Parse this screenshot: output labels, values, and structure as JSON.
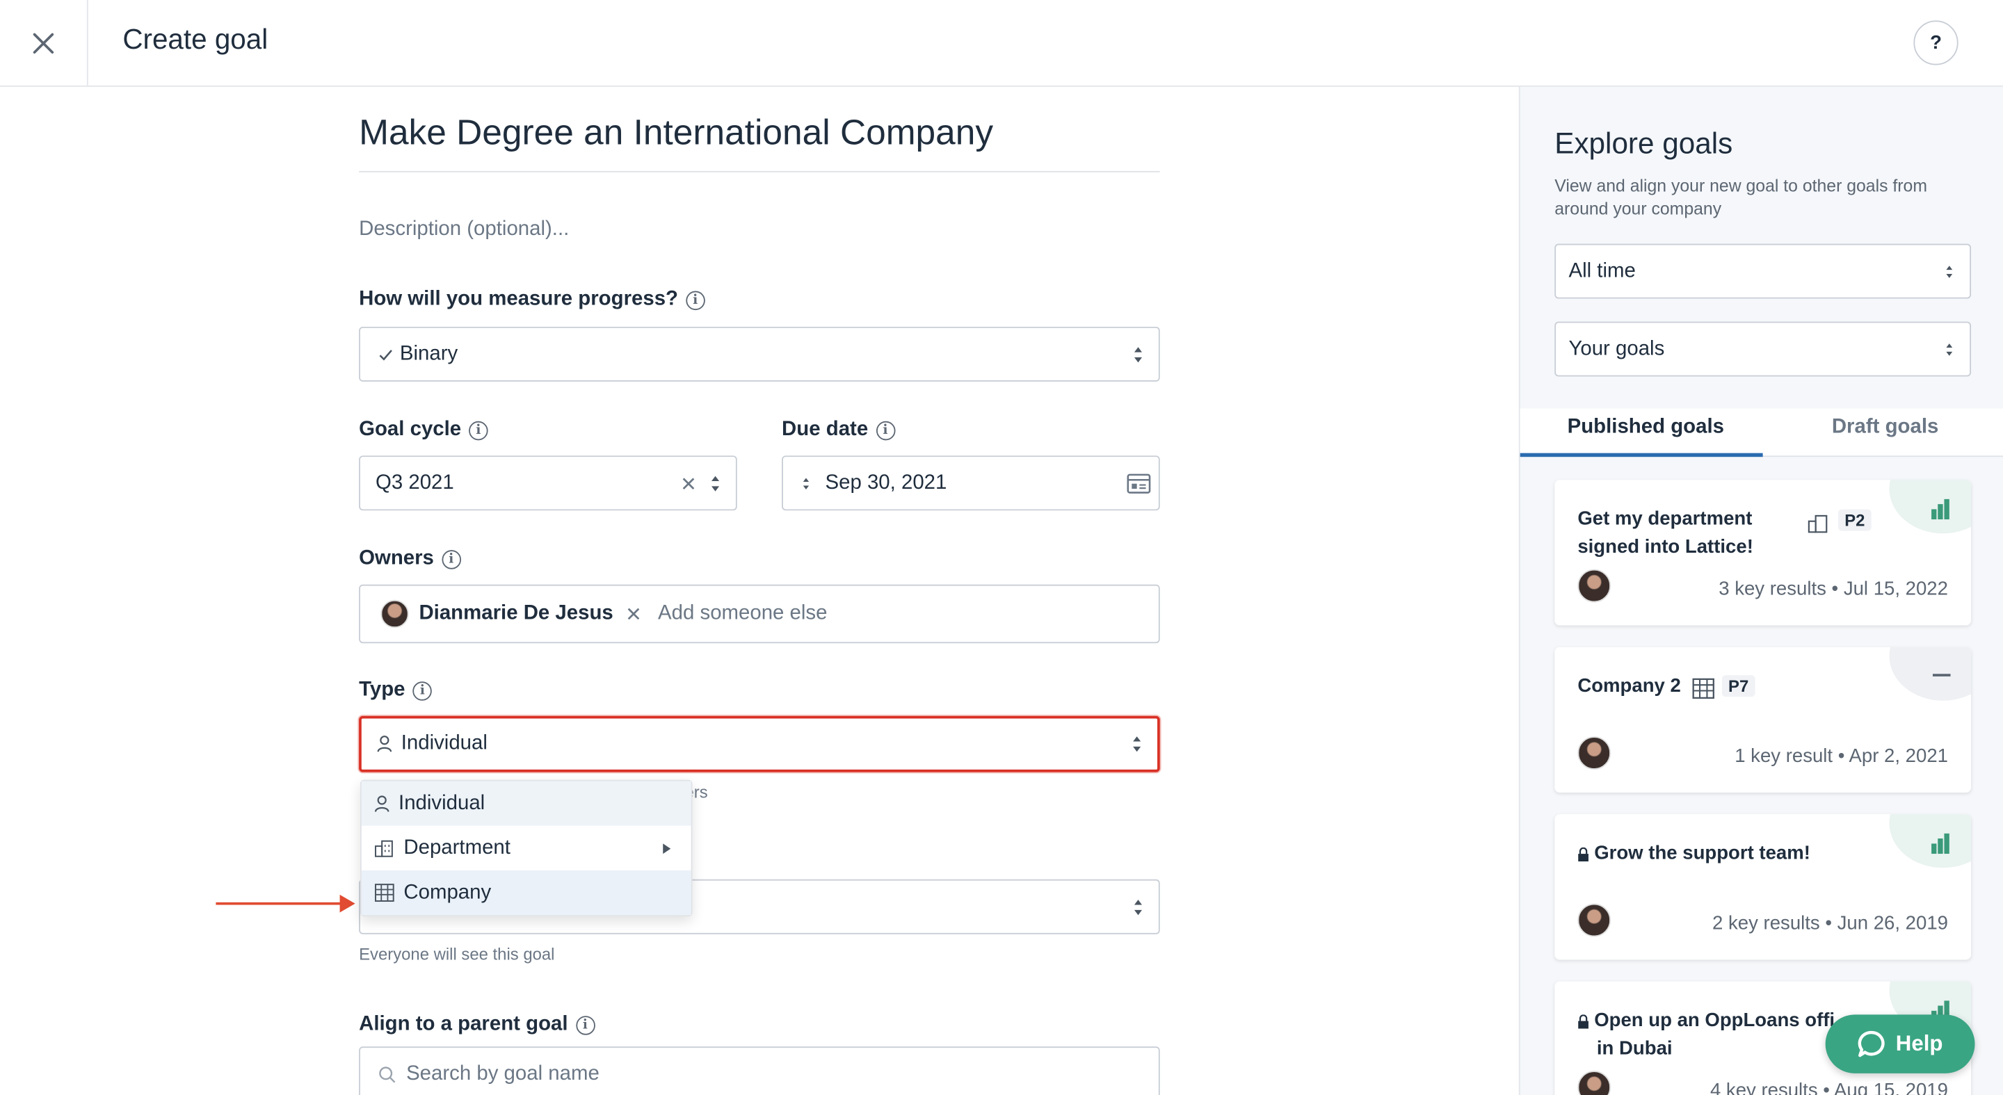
{
  "header": {
    "title": "Create goal",
    "help_label": "?"
  },
  "form": {
    "goal_title": "Make Degree an International Company",
    "description_placeholder": "Description (optional)...",
    "measure": {
      "label": "How will you measure progress?",
      "value": "Binary"
    },
    "goal_cycle": {
      "label": "Goal cycle",
      "value": "Q3 2021"
    },
    "due_date": {
      "label": "Due date",
      "value": "Sep 30, 2021"
    },
    "owners": {
      "label": "Owners",
      "owner_name": "Dianmarie De Jesus",
      "add_placeholder": "Add someone else"
    },
    "type": {
      "label": "Type",
      "value": "Individual",
      "hint_partial": "ers",
      "options": [
        {
          "label": "Individual",
          "icon": "person-icon"
        },
        {
          "label": "Department",
          "icon": "department-icon"
        },
        {
          "label": "Company",
          "icon": "company-icon"
        }
      ]
    },
    "visibility": {
      "hint": "Everyone will see this goal"
    },
    "parent_goal": {
      "label": "Align to a parent goal",
      "search_placeholder": "Search by goal name"
    }
  },
  "explore": {
    "title": "Explore goals",
    "description": "View and align your new goal to other goals from around your company",
    "time_filter": "All time",
    "scope_filter": "Your goals",
    "tabs": [
      "Published goals",
      "Draft goals"
    ],
    "cards": [
      {
        "title_line1": "Get my department",
        "title_line2": "signed into Lattice!",
        "badge": "P2",
        "meta": "3 key results • Jul 15, 2022",
        "status_icon": "bar-chart-icon"
      },
      {
        "title_line1": "Company 2",
        "badge": "P7",
        "meta": "1 key result • Apr 2, 2021",
        "status_icon": "minus-icon"
      },
      {
        "title_line1": "Grow the support team!",
        "meta": "2 key results • Jun 26, 2019",
        "status_icon": "bar-chart-icon"
      },
      {
        "title_line1": "Open up an OppLoans offi",
        "title_line2": "in Dubai",
        "meta": "4 key results • Aug 15, 2019",
        "status_icon": "bar-chart-icon"
      }
    ]
  },
  "help_button": {
    "label": "Help"
  },
  "colors": {
    "accent_green": "#3aa583",
    "error_red": "#d93025",
    "arrow_red": "#e14b32",
    "tab_blue": "#2b6cb0"
  }
}
